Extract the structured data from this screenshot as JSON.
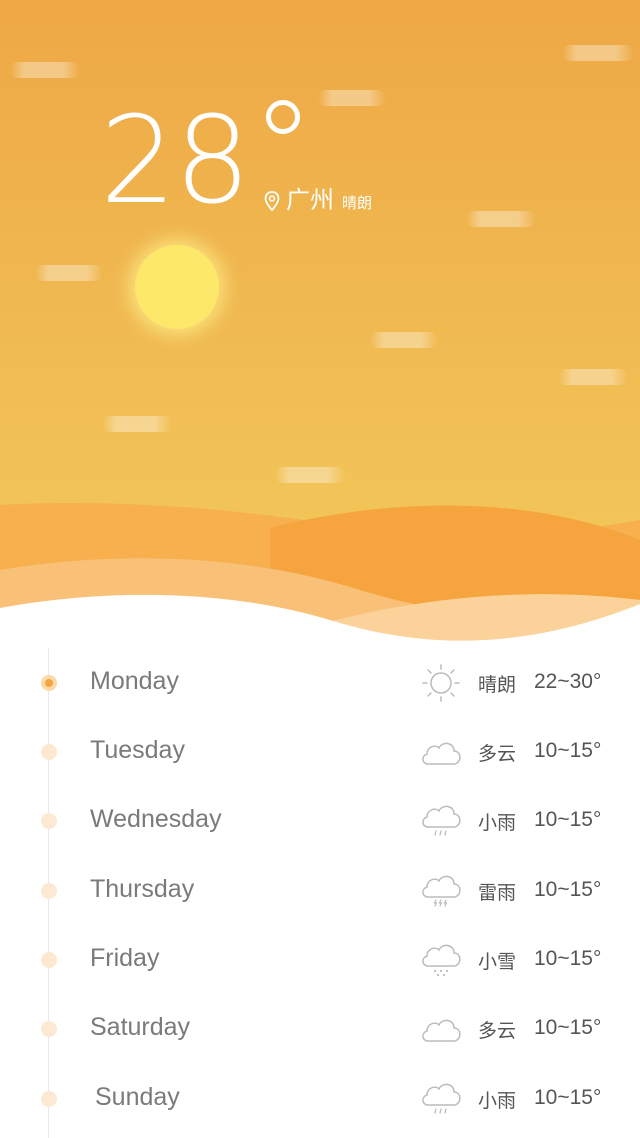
{
  "current": {
    "temperature": "28",
    "city": "广州",
    "condition": "晴朗"
  },
  "colors": {
    "sky_top": "#eea845",
    "sky_bottom": "#f3cd5e",
    "sun": "#fde86a",
    "accent": "#f3a640",
    "text": "#555555"
  },
  "forecast": [
    {
      "day": "Monday",
      "icon": "sun-icon",
      "condition": "晴朗",
      "range": "22~30°",
      "active": true
    },
    {
      "day": "Tuesday",
      "icon": "cloud-icon",
      "condition": "多云",
      "range": "10~15°",
      "active": false
    },
    {
      "day": "Wednesday",
      "icon": "rain-cloud-icon",
      "condition": "小雨",
      "range": "10~15°",
      "active": false
    },
    {
      "day": "Thursday",
      "icon": "thunder-rain-icon",
      "condition": "雷雨",
      "range": "10~15°",
      "active": false
    },
    {
      "day": "Friday",
      "icon": "snow-cloud-icon",
      "condition": "小雪",
      "range": "10~15°",
      "active": false
    },
    {
      "day": "Saturday",
      "icon": "cloud-icon",
      "condition": "多云",
      "range": "10~15°",
      "active": false
    },
    {
      "day": "Sunday",
      "icon": "rain-cloud-icon",
      "condition": "小雨",
      "range": "10~15°",
      "active": false
    }
  ]
}
